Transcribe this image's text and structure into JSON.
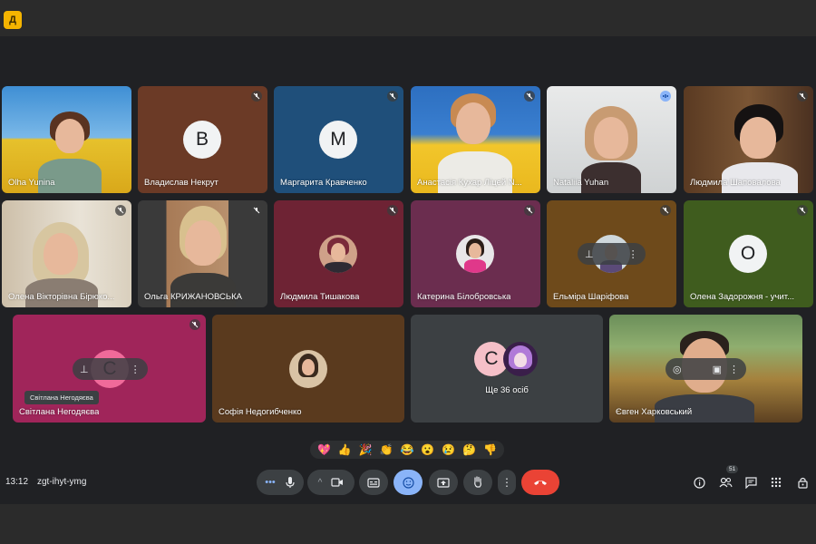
{
  "app": {
    "logo_letter": "Д"
  },
  "participants": {
    "olha": "Olha Yunina",
    "vladyslav": "Владислав Некрут",
    "marharyta": "Маргарита Кравченко",
    "anastasiia": "Анастасія Кухар Ліцей N...",
    "nataliia": "Nataliia Yuhan",
    "liudmyla_sh": "Людмила Шаповалова",
    "olena_v": "Олена Вікторівна Бірюко...",
    "olha_k": "Ольга КРИЖАНОВСЬКА",
    "liudmyla_t": "Людмила Тишакова",
    "kateryna": "Катерина Білобровська",
    "elmira": "Ельміра Шаріфова",
    "olena_z": "Олена Задорожня - учит...",
    "svitlana": "Світлана Негодяєва",
    "sofiia": "Софія Недогибченко",
    "others": "Ще 36 осіб",
    "yevhen": "Євген Харковський"
  },
  "avatars": {
    "vladyslav": "В",
    "marharyta": "М",
    "olena_z": "О",
    "svitlana": "С",
    "others": "С"
  },
  "tooltip": "Світлана Негодяєва",
  "reactions": [
    "💖",
    "👍",
    "🎉",
    "👏",
    "😂",
    "😮",
    "😢",
    "🤔",
    "👎"
  ],
  "meeting": {
    "time": "13:12",
    "code": "zgt-ihyt-ymg"
  },
  "people_count": "51",
  "colors": {
    "tile_brown": "#6b3a26",
    "tile_blue": "#1f4f7a",
    "tile_maroon": "#6e2334",
    "tile_plum": "#6b2d4f",
    "tile_ochre": "#6e4a1b",
    "tile_green": "#3f5c1e",
    "tile_magenta": "#a0255a",
    "tile_darkbrown": "#5a3a1e",
    "tile_grey": "#3c4043",
    "end_call": "#ea4335",
    "reactions_active": "#8ab4f8"
  },
  "icons": {
    "mic_off": "mic-off-icon",
    "pin": "pin-icon",
    "more": "more-vert-icon",
    "end_call": "call-end-icon",
    "raise_hand": "raise-hand-icon"
  }
}
